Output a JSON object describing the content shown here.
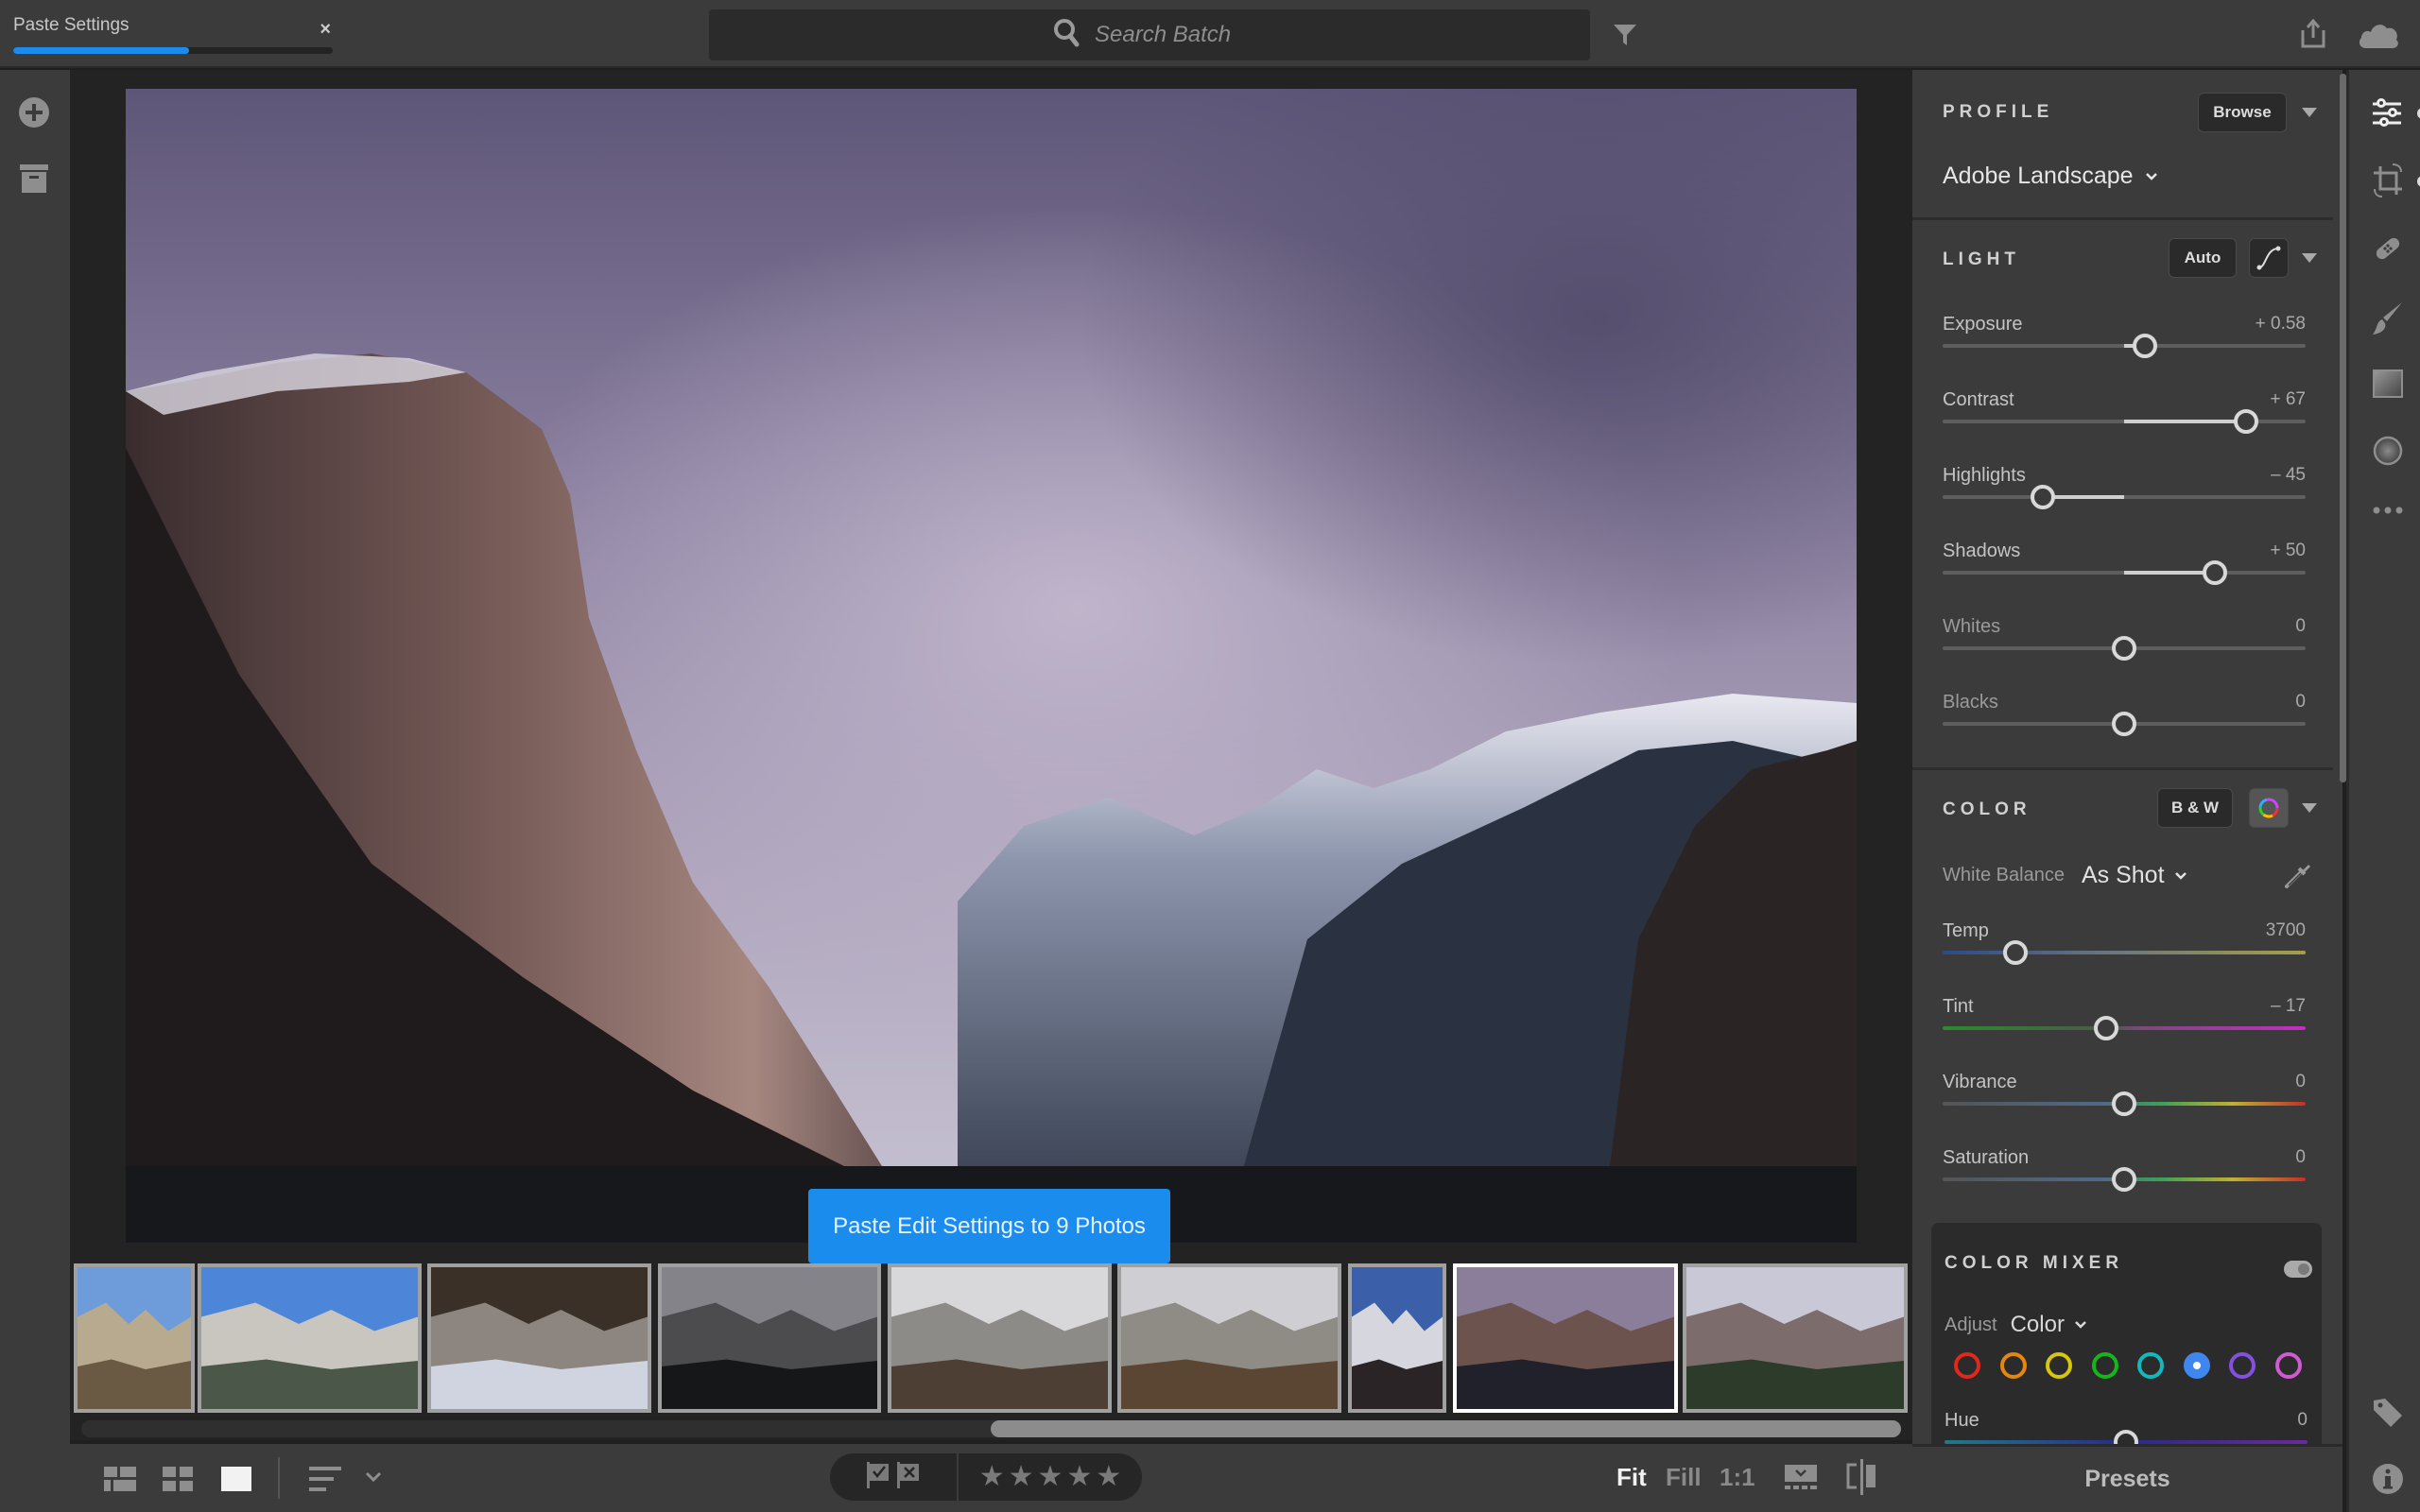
{
  "task": {
    "title": "Paste Settings",
    "progress_percent": 55,
    "close_label": "×"
  },
  "search": {
    "placeholder": "Search Batch",
    "value": ""
  },
  "icons": {
    "search": "search-icon",
    "filter": "filter-icon",
    "share": "share-icon",
    "cloud": "cloud-icon",
    "add": "add-photos-icon",
    "archive": "archive-icon"
  },
  "paste_button": {
    "label": "Paste Edit Settings to 9 Photos"
  },
  "filmstrip": {
    "thumbnails": [
      {
        "name": "yosemite-falls-meadow",
        "selected": false
      },
      {
        "name": "el-capitan-blue-sky",
        "selected": false
      },
      {
        "name": "rock-reflection",
        "selected": false
      },
      {
        "name": "misty-forest-cliff",
        "selected": false
      },
      {
        "name": "foggy-falls-trees",
        "selected": false
      },
      {
        "name": "yosemite-falls-autumn",
        "selected": false
      },
      {
        "name": "cloudy-peaks-portrait",
        "selected": false
      },
      {
        "name": "el-capitan-stormy",
        "selected": true
      },
      {
        "name": "tunnel-view",
        "selected": false
      }
    ],
    "scroll_position_percent": 50
  },
  "bottombar": {
    "view_modes": [
      "grid-large",
      "grid-small",
      "single"
    ],
    "active_view": "single",
    "flag_pick": "pick-flag-icon",
    "flag_reject": "reject-flag-icon",
    "stars": [
      "★",
      "★",
      "★",
      "★",
      "★"
    ],
    "rating": 0,
    "zoom_options": [
      "Fit",
      "Fill",
      "1:1"
    ],
    "zoom_active": "Fit"
  },
  "panel": {
    "profile": {
      "title": "PROFILE",
      "browse_label": "Browse",
      "value": "Adobe Landscape"
    },
    "light": {
      "title": "LIGHT",
      "auto_label": "Auto",
      "sliders": [
        {
          "label": "Exposure",
          "value": 0.58,
          "display": "+ 0.58",
          "min": -5,
          "max": 5
        },
        {
          "label": "Contrast",
          "value": 67,
          "display": "+ 67",
          "min": -100,
          "max": 100
        },
        {
          "label": "Highlights",
          "value": -45,
          "display": "– 45",
          "min": -100,
          "max": 100
        },
        {
          "label": "Shadows",
          "value": 50,
          "display": "+ 50",
          "min": -100,
          "max": 100
        },
        {
          "label": "Whites",
          "value": 0,
          "display": "0",
          "min": -100,
          "max": 100
        },
        {
          "label": "Blacks",
          "value": 0,
          "display": "0",
          "min": -100,
          "max": 100
        }
      ]
    },
    "color": {
      "title": "COLOR",
      "bw_label": "B & W",
      "white_balance_label": "White Balance",
      "white_balance_value": "As Shot",
      "sliders": [
        {
          "label": "Temp",
          "value": 3700,
          "display": "3700",
          "min": 2000,
          "max": 50000,
          "position_percent": 20
        },
        {
          "label": "Tint",
          "value": -17,
          "display": "– 17",
          "min": -150,
          "max": 150,
          "position_percent": 45
        },
        {
          "label": "Vibrance",
          "value": 0,
          "display": "0",
          "min": -100,
          "max": 100
        },
        {
          "label": "Saturation",
          "value": 0,
          "display": "0",
          "min": -100,
          "max": 100
        }
      ]
    },
    "color_mixer": {
      "title": "COLOR MIXER",
      "enabled": true,
      "adjust_label": "Adjust",
      "adjust_value": "Color",
      "swatches": [
        {
          "name": "red",
          "color": "#e0281c"
        },
        {
          "name": "orange",
          "color": "#e5870f"
        },
        {
          "name": "yellow",
          "color": "#d6c60e"
        },
        {
          "name": "green",
          "color": "#15b61c"
        },
        {
          "name": "aqua",
          "color": "#13b8bd"
        },
        {
          "name": "blue",
          "color": "#3f86ee",
          "selected": true
        },
        {
          "name": "purple",
          "color": "#8450e0"
        },
        {
          "name": "magenta",
          "color": "#d05ad0"
        }
      ],
      "sliders": [
        {
          "label": "Hue",
          "value": 0,
          "display": "0",
          "min": -100,
          "max": 100
        }
      ]
    },
    "presets_label": "Presets"
  },
  "rail": {
    "tools": [
      "edit-sliders-icon",
      "crop-icon",
      "healing-icon",
      "brush-icon",
      "linear-gradient-icon",
      "radial-gradient-icon",
      "more-icon"
    ],
    "bottom_tools": [
      "keyword-tag-icon",
      "info-icon"
    ]
  },
  "colors": {
    "accent": "#1a8cf0",
    "panel_bg": "#3b3b3b",
    "stage_bg": "#232323"
  }
}
